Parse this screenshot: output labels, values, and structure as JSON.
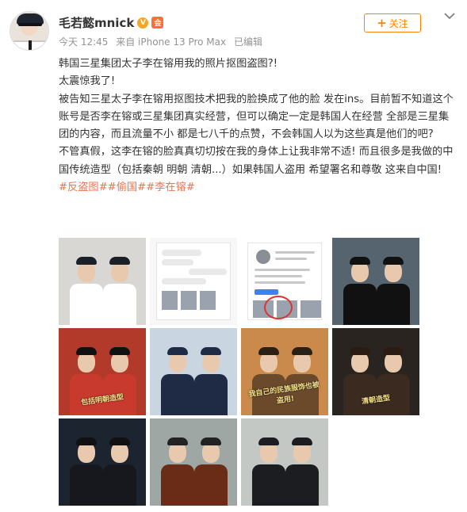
{
  "user": {
    "name": "毛若懿mnick",
    "verified_badge": "V",
    "vip_badge": "会"
  },
  "meta": {
    "time": "今天 12:45",
    "source": "来自 iPhone 13 Pro Max",
    "edited": "已编辑"
  },
  "follow_button": {
    "icon": "plus-icon",
    "label": "关注"
  },
  "post": {
    "lines": [
      "韩国三星集团太子李在镕用我的照片抠图盗图?!",
      "太震惊我了!",
      "被告知三星太子李在镕用抠图技术把我的脸换成了他的脸 发在ins。目前暂不知道这个账号是否李在镕或三星集团真实经营，但可以确定一定是韩国人在经营 全部是三星集团的内容，而且流量不小 都是七八千的点赞，不会韩国人以为这些真是他们的吧?",
      "不管真假，这李在镕的脸真真切切按在我的身体上让我非常不适! 而且很多是我做的中国传统造型（包括秦朝 明朝 清朝...）如果韩国人盗用 希望署名和尊敬 这来自中国!"
    ],
    "tags": [
      "#反盗图#",
      "#偷国#",
      "#李在镕#"
    ]
  },
  "images": [
    {
      "kind": "pilot",
      "bg": "#d9d7d3",
      "body": "#ffffff",
      "hat": "#1b1f27",
      "caption": ""
    },
    {
      "kind": "chat",
      "bg": "#f7f7f7",
      "caption": ""
    },
    {
      "kind": "profile",
      "bg": "#ffffff",
      "caption": ""
    },
    {
      "kind": "qin",
      "bg": "#55646e",
      "body": "#111111",
      "hat": "#111111",
      "caption": ""
    },
    {
      "kind": "ming",
      "bg": "#b23a2a",
      "body": "#c83a2e",
      "hat": "#111111",
      "caption": "包括明朝造型"
    },
    {
      "kind": "guard",
      "bg": "#c9d6e2",
      "body": "#1f2a44",
      "hat": "#1f2a44",
      "caption": ""
    },
    {
      "kind": "qing",
      "bg": "#c98a4b",
      "body": "#6b4a2c",
      "hat": "#2a2014",
      "caption": "我自己的民族服饰也被盗用!"
    },
    {
      "kind": "qing2",
      "bg": "#2a2420",
      "body": "#3a2a20",
      "hat": "#2a1c12",
      "caption": "清朝造型"
    },
    {
      "kind": "cockpit",
      "bg": "#1c2430",
      "body": "#16181d",
      "hat": "#111111",
      "caption": ""
    },
    {
      "kind": "monk",
      "bg": "#9ea7a4",
      "body": "#6a2b17",
      "hat": "#222222",
      "caption": ""
    },
    {
      "kind": "tactical",
      "bg": "#c4c8c5",
      "body": "#1b1d20",
      "hat": "#1b1d20",
      "caption": ""
    }
  ]
}
